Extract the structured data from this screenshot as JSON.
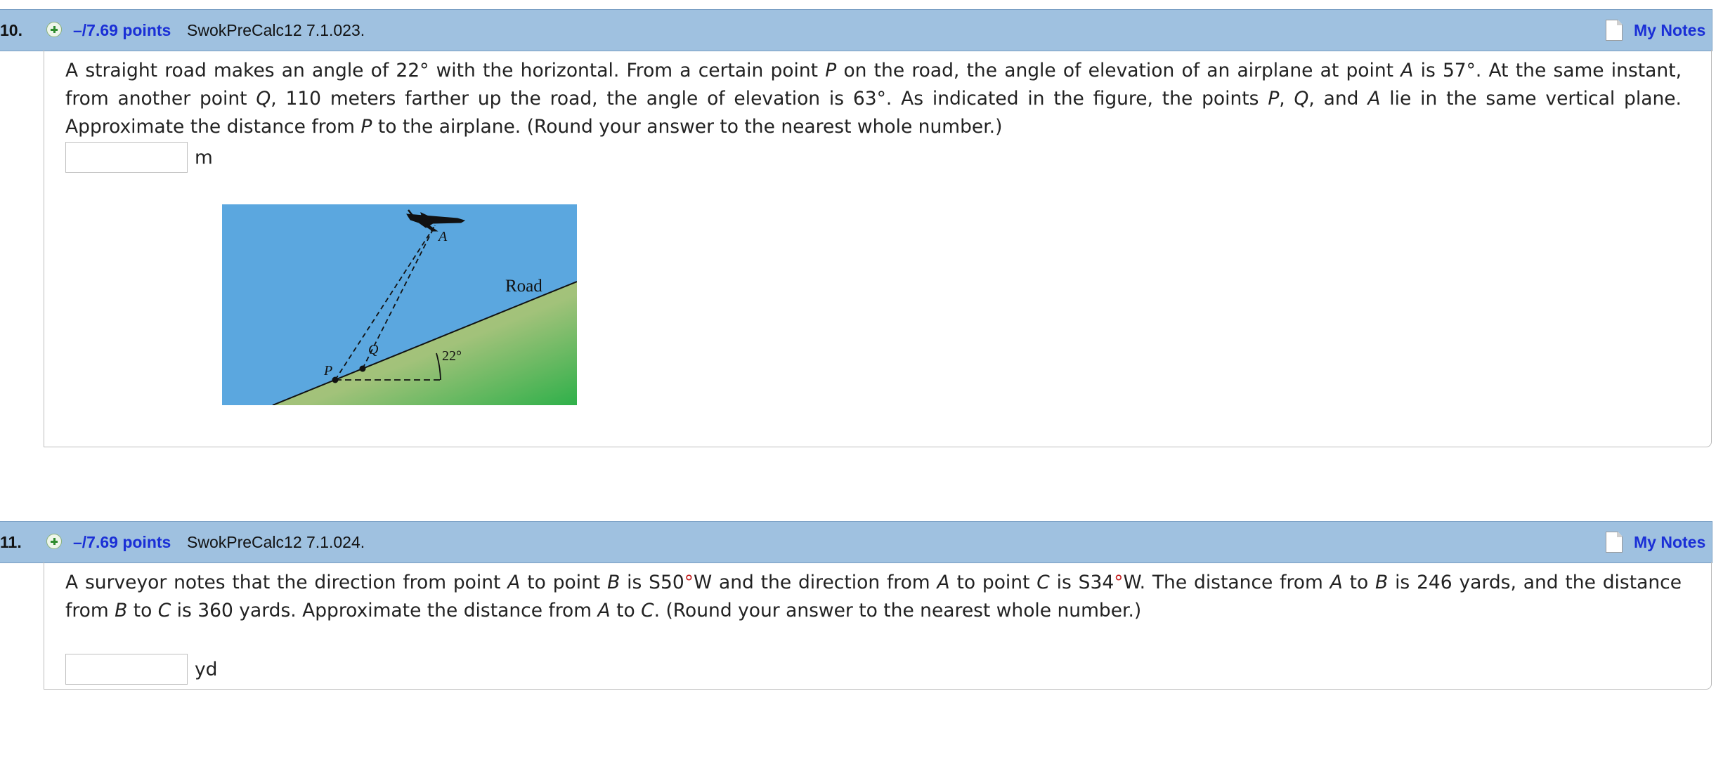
{
  "questions": [
    {
      "number": "10.",
      "points": "–/7.69 points",
      "reference": "SwokPreCalc12 7.1.023.",
      "notes_label": "My Notes",
      "text_parts": [
        "A straight road makes an angle of 22° with the horizontal. From a certain point ",
        "P",
        " on the road, the angle of elevation of an airplane at point ",
        "A",
        " is 57°. At the same instant, from another point ",
        "Q",
        ", 110 meters farther up the road, the angle of elevation is 63°. As indicated in the figure, the points ",
        "P",
        ", ",
        "Q",
        ", and ",
        "A",
        " lie in the same vertical plane. Approximate the distance from ",
        "P",
        " to the airplane. (Round your answer to the nearest whole number.)"
      ],
      "answer_value": "",
      "unit": "m",
      "figure": {
        "label_a": "A",
        "label_p": "P",
        "label_q": "Q",
        "label_road": "Road",
        "label_angle": "22°",
        "sky_color": "#5ba7df",
        "ground_color_light": "#b3c47f",
        "ground_color_dark": "#2fb04a"
      }
    },
    {
      "number": "11.",
      "points": "–/7.69 points",
      "reference": "SwokPreCalc12 7.1.024.",
      "notes_label": "My Notes",
      "text_parts": [
        "A surveyor notes that the direction from point ",
        "A",
        " to point ",
        "B",
        " is S50",
        "°",
        "W and the direction from ",
        "A",
        " to point ",
        "C",
        " is S34",
        "°",
        "W. The distance from ",
        "A",
        " to ",
        "B",
        " is 246 yards, and the distance from ",
        "B",
        " to ",
        "C",
        " is 360 yards. Approximate the distance from ",
        "A",
        " to ",
        "C",
        ". (Round your answer to the nearest whole number.)"
      ],
      "answer_value": "",
      "unit": "yd"
    }
  ],
  "colors": {
    "header_bg": "#9fc1e0",
    "link": "#1a2fd6",
    "degree_red": "#c41e1e"
  }
}
